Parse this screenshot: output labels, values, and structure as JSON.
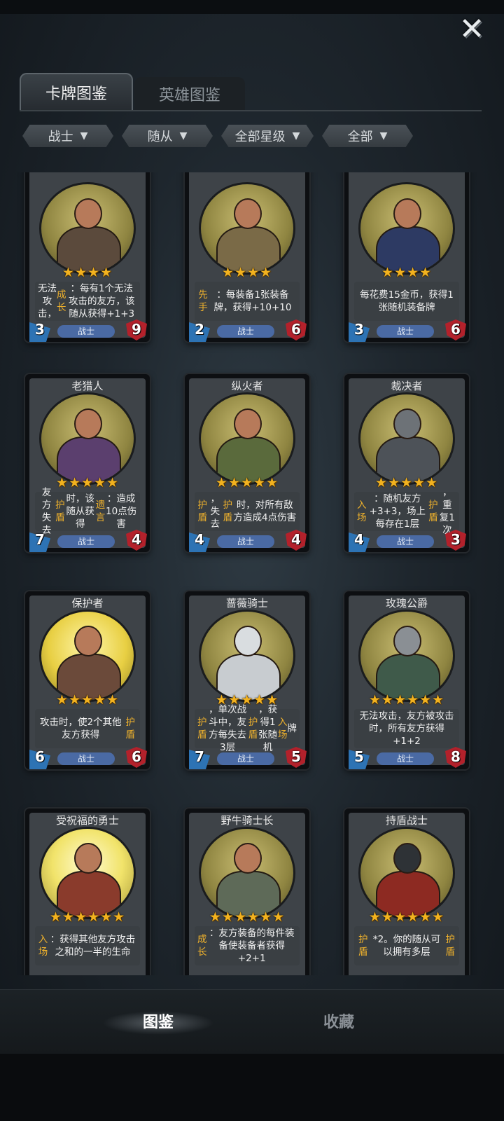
{
  "tabs": {
    "cards": "卡牌图鉴",
    "heroes": "英雄图鉴"
  },
  "filters": [
    {
      "label": "战士"
    },
    {
      "label": "随从"
    },
    {
      "label": "全部星级"
    },
    {
      "label": "全部"
    }
  ],
  "cards": [
    {
      "name": "",
      "stars": "★★★★",
      "desc_html": "无法攻击，<span class='hl'>成长</span>：每有1个无法攻击的友方，该随从获得+1+3",
      "cost": "3",
      "hp": "9",
      "class": "战士"
    },
    {
      "name": "",
      "stars": "★★★★",
      "desc_html": "<span class='hl'>先手</span>：每装备1张装备牌，获得+10+10",
      "cost": "2",
      "hp": "6",
      "class": "战士"
    },
    {
      "name": "",
      "stars": "★★★★",
      "desc_html": "每花费15金币，获得1张随机装备牌",
      "cost": "3",
      "hp": "6",
      "class": "战士"
    },
    {
      "name": "老猎人",
      "stars": "★★★★★",
      "desc_html": "友方失去<span class='hl'>护盾</span>时，该随从获得<span class='hl'>遗言</span>：造成10点伤害",
      "cost": "7",
      "hp": "4",
      "class": "战士"
    },
    {
      "name": "纵火者",
      "stars": "★★★★★",
      "desc_html": "<span class='hl'>护盾</span>，失去<span class='hl'>护盾</span>时，对所有敌方造成4点伤害",
      "cost": "4",
      "hp": "4",
      "class": "战士"
    },
    {
      "name": "裁决者",
      "stars": "★★★★★",
      "desc_html": "<span class='hl'>入场</span>：随机友方+3+3，场上每存在1层<span class='hl'>护盾</span>，重复1次",
      "cost": "4",
      "hp": "3",
      "class": "战士"
    },
    {
      "name": "保护者",
      "stars": "★★★★★",
      "desc_html": "攻击时，使2个其他友方获得<span class='hl'>护盾</span>",
      "cost": "6",
      "hp": "6",
      "class": "战士"
    },
    {
      "name": "蔷薇骑士",
      "stars": "★★★★★",
      "desc_html": "<span class='hl'>护盾</span>，单次战斗中，友方每失去3层<span class='hl'>护盾</span>，获得1张随机<span class='hl'>入场</span>牌",
      "cost": "7",
      "hp": "5",
      "class": "战士"
    },
    {
      "name": "玫瑰公爵",
      "stars": "★★★★★★",
      "desc_html": "无法攻击，友方被攻击时，所有友方获得+1+2",
      "cost": "5",
      "hp": "8",
      "class": "战士"
    },
    {
      "name": "受祝福的勇士",
      "stars": "★★★★★★",
      "desc_html": "<span class='hl'>入场</span>：获得其他友方攻击之和的一半的生命",
      "cost": "",
      "hp": "",
      "class": ""
    },
    {
      "name": "野牛骑士长",
      "stars": "★★★★★★",
      "desc_html": "<span class='hl'>成长</span>：友方装备的每件装备使装备者获得+2+1",
      "cost": "",
      "hp": "",
      "class": ""
    },
    {
      "name": "持盾战士",
      "stars": "★★★★★★",
      "desc_html": "<span class='hl'>护盾</span>*2。你的随从可以拥有多层<span class='hl'>护盾</span>",
      "cost": "",
      "hp": "",
      "class": ""
    }
  ],
  "nav": {
    "codex": "图鉴",
    "collection": "收藏"
  },
  "colors": {
    "star": "#f2b21f",
    "highlight": "#f0b22c",
    "cost": "#2d73b4",
    "hp": "#b3212b"
  }
}
